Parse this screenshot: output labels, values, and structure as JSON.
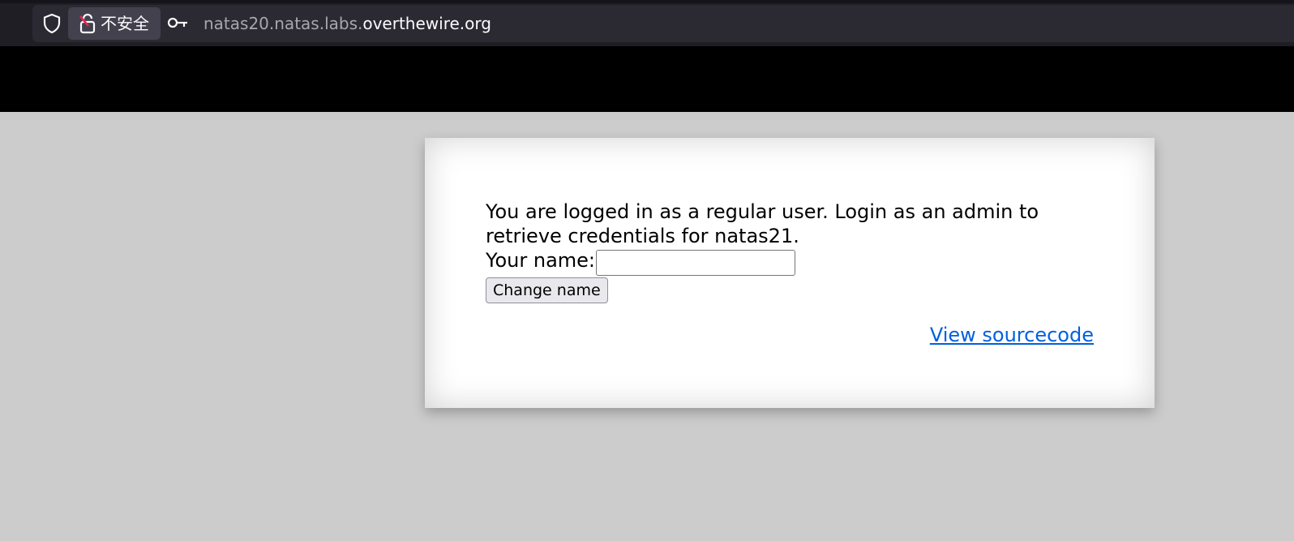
{
  "browser": {
    "security_label": "不安全",
    "url_prefix": "natas20.natas.labs.",
    "url_host": "overthewire.org",
    "icons": {
      "shield": "shield-icon",
      "lock": "insecure-lock-icon",
      "key": "key-icon"
    }
  },
  "page": {
    "message": "You are logged in as a regular user. Login as an admin to retrieve credentials for natas21.",
    "name_label": "Your name:",
    "name_value": "",
    "change_button_label": "Change name",
    "source_link_label": "View sourcecode"
  }
}
